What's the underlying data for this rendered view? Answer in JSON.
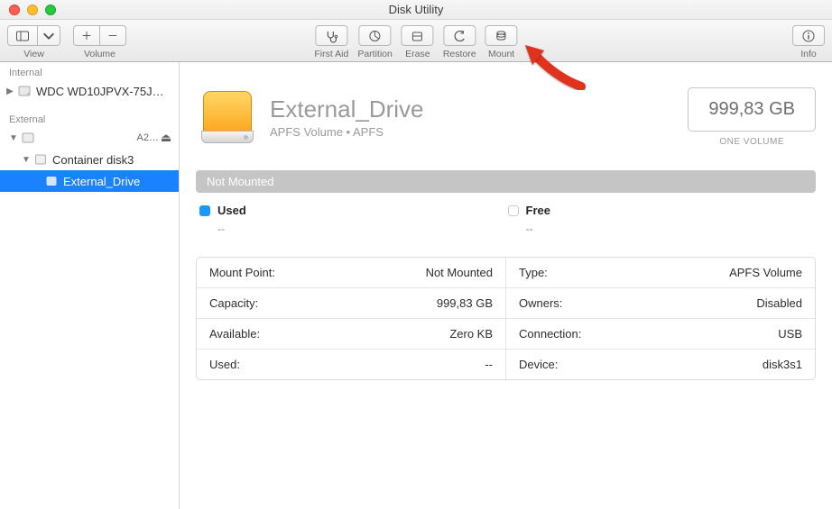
{
  "window": {
    "title": "Disk Utility"
  },
  "toolbar": {
    "view_label": "View",
    "volume_label": "Volume",
    "firstaid": "First Aid",
    "partition": "Partition",
    "erase": "Erase",
    "restore": "Restore",
    "mount": "Mount",
    "info": "Info"
  },
  "sidebar": {
    "sections": {
      "internal": "Internal",
      "external": "External"
    },
    "internal0": "WDC WD10JPVX-75J…",
    "external0": "A2…",
    "container": "Container disk3",
    "selected": "External_Drive"
  },
  "header": {
    "name": "External_Drive",
    "subtitle": "APFS Volume • APFS",
    "size": "999,83 GB",
    "size_label": "ONE VOLUME"
  },
  "status_text": "Not Mounted",
  "legend": {
    "used_label": "Used",
    "used_value": "--",
    "free_label": "Free",
    "free_value": "--",
    "used_color": "#1a99ff",
    "free_color": "#ffffff"
  },
  "info": {
    "mount_point_k": "Mount Point:",
    "mount_point_v": "Not Mounted",
    "type_k": "Type:",
    "type_v": "APFS Volume",
    "capacity_k": "Capacity:",
    "capacity_v": "999,83 GB",
    "owners_k": "Owners:",
    "owners_v": "Disabled",
    "available_k": "Available:",
    "available_v": "Zero KB",
    "connection_k": "Connection:",
    "connection_v": "USB",
    "used_k": "Used:",
    "used_v": "--",
    "device_k": "Device:",
    "device_v": "disk3s1"
  }
}
